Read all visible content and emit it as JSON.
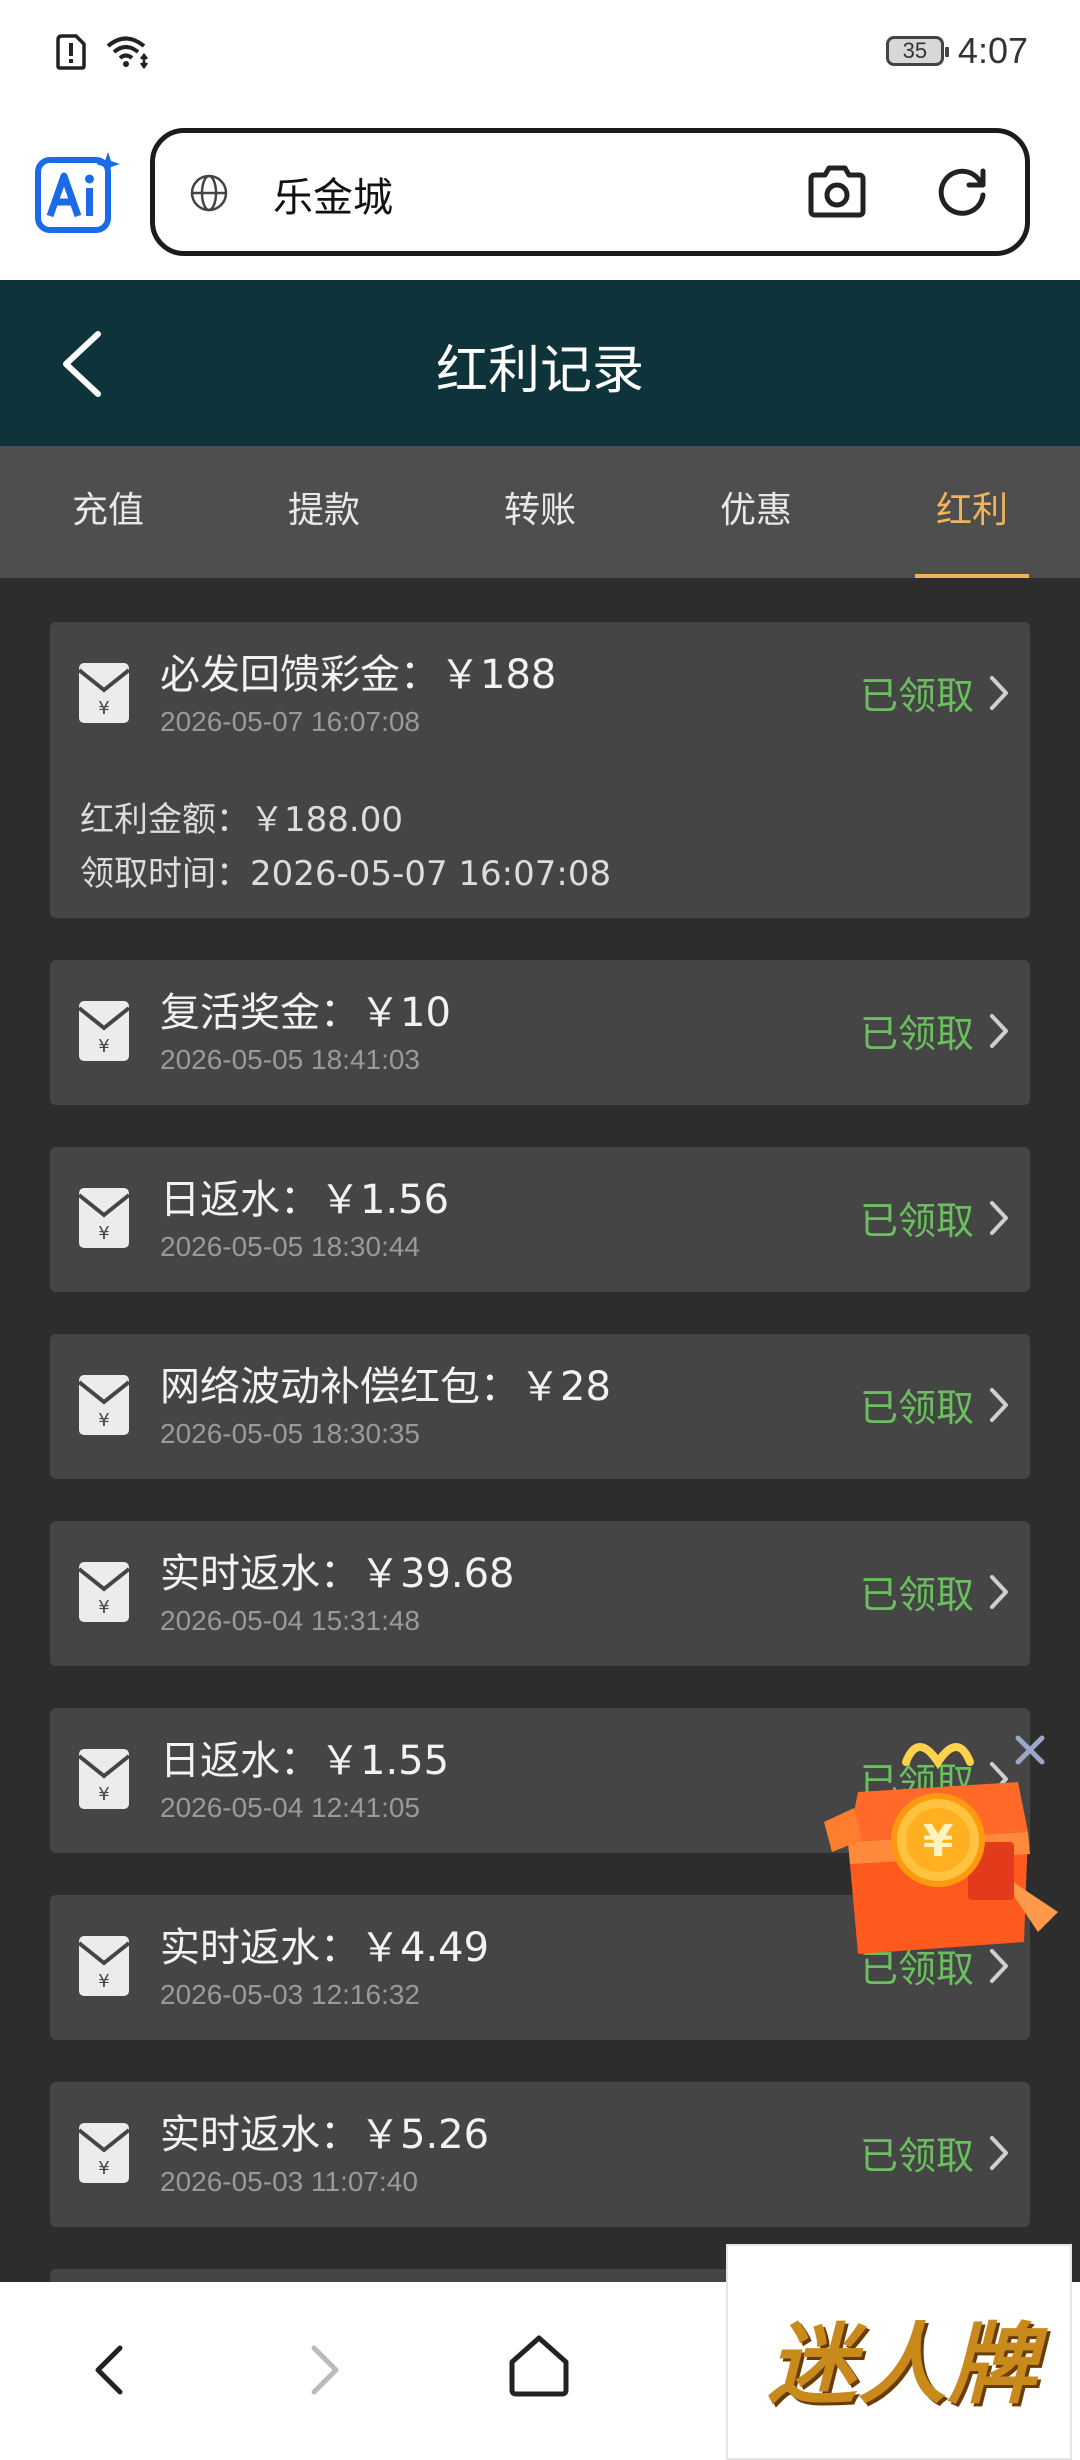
{
  "status_bar": {
    "time": "4:07",
    "battery": "35"
  },
  "browser": {
    "url_text": "乐金城"
  },
  "header": {
    "title": "红利记录"
  },
  "tabs": [
    {
      "label": "充值"
    },
    {
      "label": "提款"
    },
    {
      "label": "转账"
    },
    {
      "label": "优惠"
    },
    {
      "label": "红利",
      "active": true
    }
  ],
  "records": [
    {
      "title": "必发回馈彩金：￥188",
      "date": "2026-05-07 16:07:08",
      "status": "已领取",
      "expanded": true,
      "detail_amount": "红利金额：￥188.00",
      "detail_time": "领取时间：2026-05-07 16:07:08"
    },
    {
      "title": "复活奖金：￥10",
      "date": "2026-05-05 18:41:03",
      "status": "已领取"
    },
    {
      "title": "日返水：￥1.56",
      "date": "2026-05-05 18:30:44",
      "status": "已领取"
    },
    {
      "title": "网络波动补偿红包：￥28",
      "date": "2026-05-05 18:30:35",
      "status": "已领取"
    },
    {
      "title": "实时返水：￥39.68",
      "date": "2026-05-04 15:31:48",
      "status": "已领取"
    },
    {
      "title": "日返水：￥1.55",
      "date": "2026-05-04 12:41:05",
      "status": "已领取"
    },
    {
      "title": "实时返水：￥4.49",
      "date": "2026-05-03 12:16:32",
      "status": "已领取"
    },
    {
      "title": "实时返水：￥5.26",
      "date": "2026-05-03 11:07:40",
      "status": "已领取"
    }
  ],
  "watermark": {
    "text": "迷人牌"
  },
  "colors": {
    "header_bg": "#0e333b",
    "tab_active": "#f0b55a",
    "status_green": "#6bbf5f",
    "card_bg": "#454545",
    "page_bg": "#2d2d2d"
  }
}
